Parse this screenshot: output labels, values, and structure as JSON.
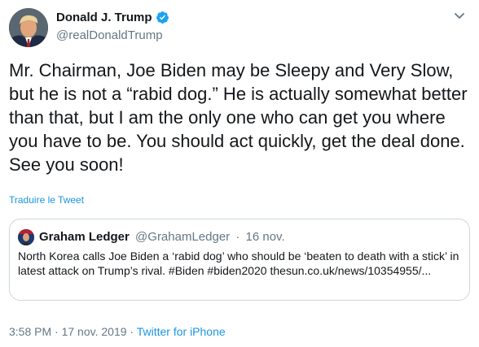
{
  "author": {
    "name": "Donald J. Trump",
    "handle": "@realDonaldTrump",
    "verified": true
  },
  "tweet": {
    "text": "Mr. Chairman, Joe Biden may be Sleepy and Very Slow, but he is not a “rabid dog.” He is actually somewhat better than that, but I am the only one who can get you where you have to be. You should act quickly, get the deal done. See you soon!",
    "translate_label": "Traduire le Tweet"
  },
  "quoted_tweet": {
    "name": "Graham Ledger",
    "handle": "@GrahamLedger",
    "separator": "·",
    "date": "16 nov.",
    "text": "North Korea calls Joe Biden a ‘rabid dog’ who should be ‘beaten to death with a stick’ in latest attack on Trump’s rival. #Biden #biden2020 thesun.co.uk/news/10354955/..."
  },
  "footer": {
    "time": "3:58 PM",
    "separator1": "·",
    "date": "17 nov. 2019",
    "separator2": "·",
    "source": "Twitter for iPhone"
  },
  "colors": {
    "link": "#1b95e0",
    "secondary": "#657786",
    "border": "#ccd6dd",
    "verified": "#1da1f2"
  },
  "icons": {
    "verified": "verified-badge-icon",
    "caret": "chevron-down-icon"
  }
}
